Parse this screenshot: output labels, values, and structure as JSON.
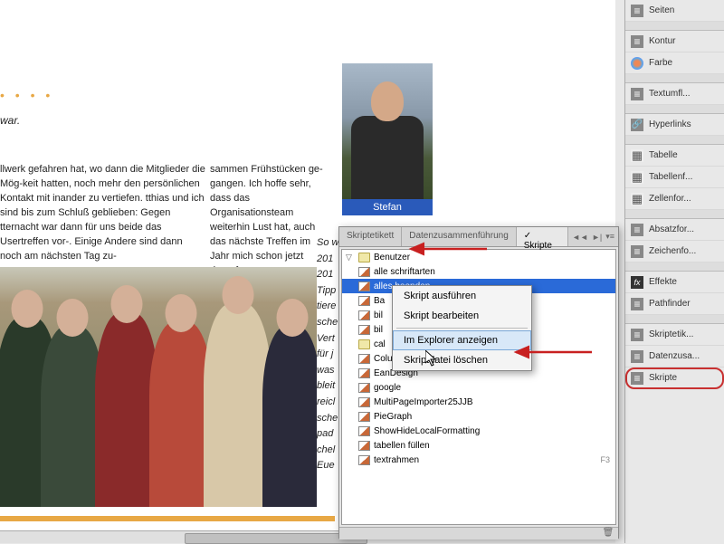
{
  "document": {
    "bullets": "• • • •",
    "war": "war.",
    "col_left": "llwerk gefahren hat, wo dann die Mitglieder die Mög-keit hatten, noch mehr den persönlichen Kontakt mit inander zu vertiefen.\ntthias und ich sind bis zum Schluß geblieben: Gegen tternacht war dann für uns beide das Usertreffen vor-. Einige Andere sind dann noch am nächsten Tag zu-",
    "col_right": "sammen Frühstücken ge-gangen. Ich hoffe sehr, dass das Organisationsteam weiterhin Lust hat, auch das nächste Treffen im Jahr mich schon jetzt darauf.",
    "portrait_caption": "Stefan",
    "italic_lines": [
      "So w",
      "201",
      "201",
      "Tipp",
      "tiere",
      "sche",
      "Vert",
      "für j",
      "was",
      "bleit",
      "reicl",
      "sche",
      "pad",
      "chel",
      "",
      "Eue"
    ]
  },
  "scripts_panel": {
    "tabs": [
      "Skriptetikett",
      "Datenzusammenführung",
      "Skripte"
    ],
    "active_tab": 2,
    "tree": [
      {
        "type": "folder",
        "label": "Benutzer",
        "expanded": true
      },
      {
        "type": "script",
        "label": "alle schriftarten"
      },
      {
        "type": "script",
        "label": "alles beenden",
        "selected": true
      },
      {
        "type": "script",
        "label": "Ba"
      },
      {
        "type": "script",
        "label": "bil"
      },
      {
        "type": "script",
        "label": "bil"
      },
      {
        "type": "folder-sub",
        "label": "cal"
      },
      {
        "type": "script",
        "label": "ColumnGraph"
      },
      {
        "type": "script",
        "label": "EanDesign"
      },
      {
        "type": "script",
        "label": "google"
      },
      {
        "type": "script",
        "label": "MultiPageImporter25JJB"
      },
      {
        "type": "script",
        "label": "PieGraph"
      },
      {
        "type": "script",
        "label": "ShowHideLocalFormatting"
      },
      {
        "type": "script",
        "label": "tabellen füllen"
      },
      {
        "type": "script",
        "label": "textrahmen",
        "shortcut": "F3"
      }
    ]
  },
  "context_menu": {
    "items": [
      {
        "label": "Skript ausführen"
      },
      {
        "label": "Skript bearbeiten"
      },
      {
        "sep": true
      },
      {
        "label": "Im Explorer anzeigen",
        "hover": true
      },
      {
        "label": "Skriptdatei löschen"
      }
    ]
  },
  "right_panels": [
    {
      "label": "Seiten",
      "icon": "lines"
    },
    {
      "sep": true
    },
    {
      "label": "Kontur",
      "icon": "lines"
    },
    {
      "label": "Farbe",
      "icon": "palette"
    },
    {
      "sep": true
    },
    {
      "label": "Textumfl...",
      "icon": "lines"
    },
    {
      "sep": true
    },
    {
      "label": "Hyperlinks",
      "icon": "link"
    },
    {
      "sep": true
    },
    {
      "label": "Tabelle",
      "icon": "table"
    },
    {
      "label": "Tabellenf...",
      "icon": "table"
    },
    {
      "label": "Zellenfor...",
      "icon": "table"
    },
    {
      "sep": true
    },
    {
      "label": "Absatzfor...",
      "icon": "lines"
    },
    {
      "label": "Zeichenfo...",
      "icon": "lines"
    },
    {
      "sep": true
    },
    {
      "label": "Effekte",
      "icon": "fx"
    },
    {
      "label": "Pathfinder",
      "icon": "lines"
    },
    {
      "sep": true
    },
    {
      "label": "Skriptetik...",
      "icon": "lines"
    },
    {
      "label": "Datenzusa...",
      "icon": "lines"
    },
    {
      "label": "Skripte",
      "icon": "lines",
      "highlighted": true
    }
  ]
}
